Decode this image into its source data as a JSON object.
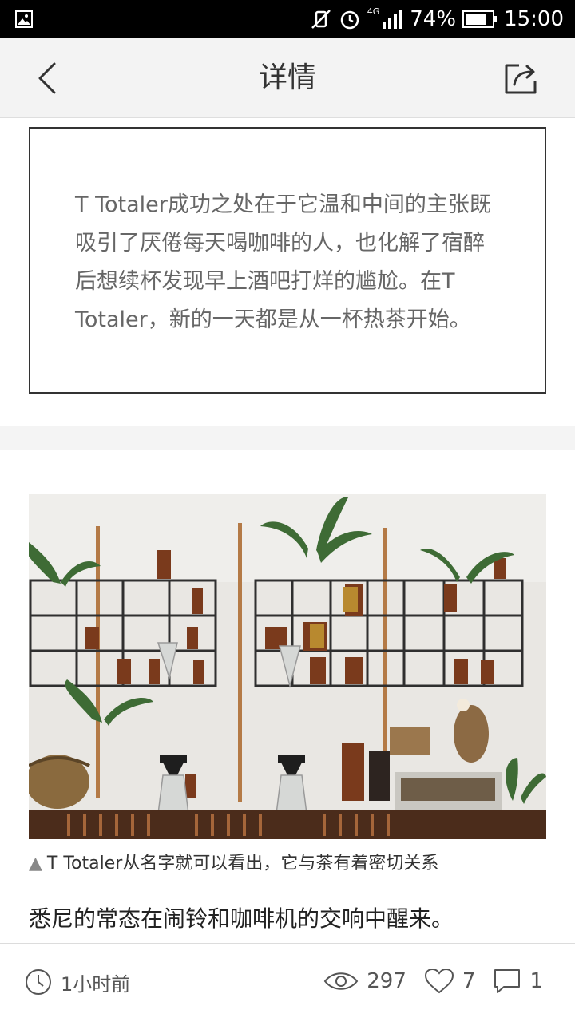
{
  "status_bar": {
    "network": "4G",
    "battery": "74%",
    "time": "15:00",
    "icons": [
      "image-icon",
      "mute-vibrate-icon",
      "alarm-icon",
      "signal-icon",
      "battery-icon"
    ]
  },
  "header": {
    "title": "详情",
    "icons": [
      "back-arrow-icon",
      "share-icon"
    ]
  },
  "article": {
    "quote": "T Totaler成功之处在于它温和中间的主张既吸引了厌倦每天喝咖啡的人，也化解了宿醉后想续杯发现早上酒吧打烊的尴尬。在T Totaler，新的一天都是从一杯热茶开始。",
    "caption_marker": "▲",
    "caption": "T Totaler从名字就可以看出，它与茶有着密切关系",
    "paragraph": "悉尼的常态在闹铃和咖啡机的交响中醒来。"
  },
  "footer": {
    "time_ago": "1小时前",
    "views": "297",
    "likes": "7",
    "comments": "1",
    "icons": [
      "clock-icon",
      "eye-icon",
      "heart-icon",
      "comment-icon"
    ]
  }
}
